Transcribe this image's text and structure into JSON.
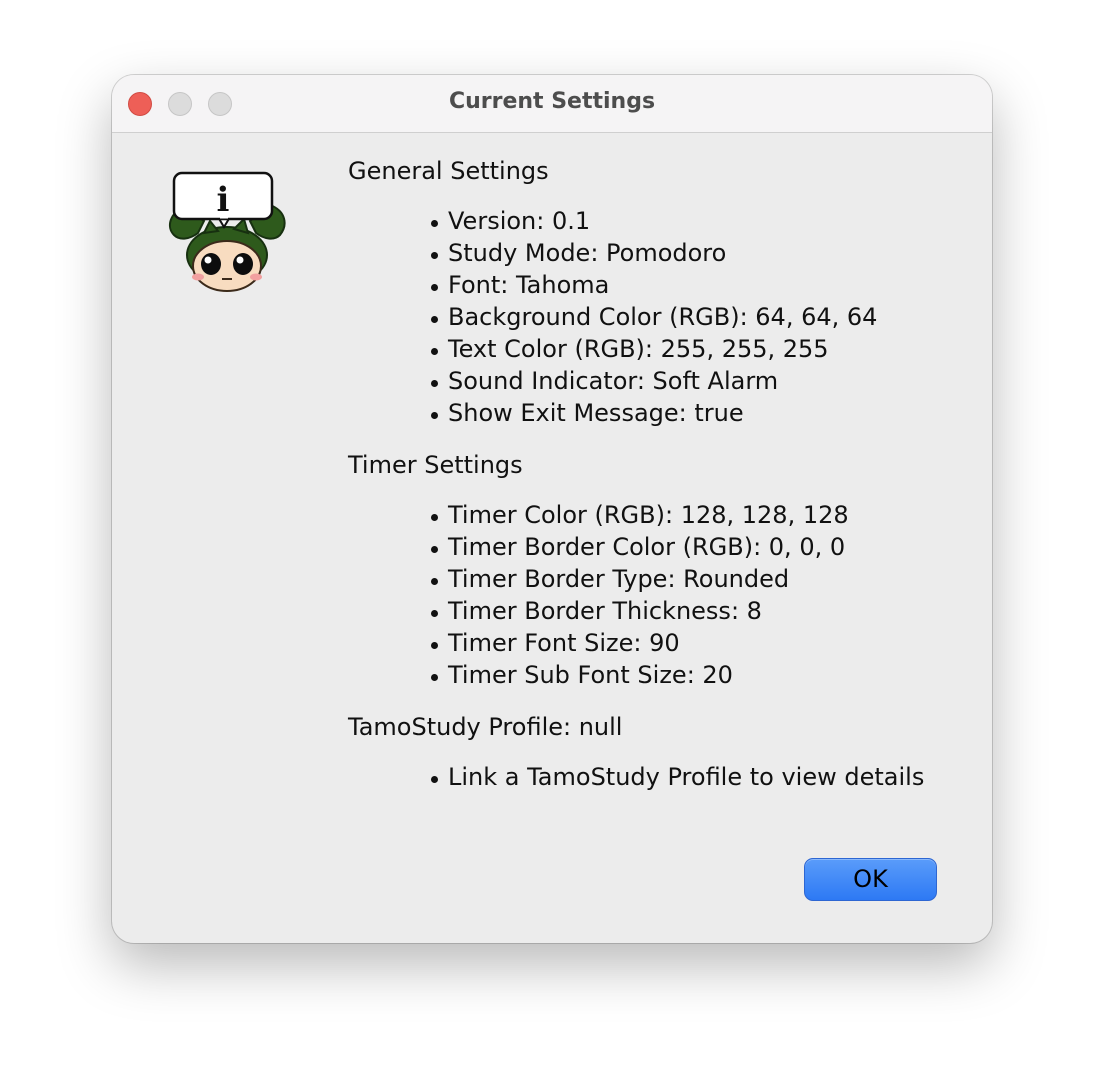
{
  "window": {
    "title": "Current Settings"
  },
  "icon": {
    "semantic": "info-mascot-icon",
    "glyph": "i"
  },
  "sections": {
    "general": {
      "title": "General Settings",
      "items": [
        "Version: 0.1",
        "Study Mode: Pomodoro",
        "Font: Tahoma",
        "Background Color (RGB): 64, 64, 64",
        "Text Color (RGB): 255, 255, 255",
        "Sound Indicator: Soft Alarm",
        "Show Exit Message: true"
      ]
    },
    "timer": {
      "title": "Timer Settings",
      "items": [
        "Timer Color (RGB): 128, 128, 128",
        "Timer Border Color (RGB): 0, 0, 0",
        "Timer Border Type: Rounded",
        "Timer Border Thickness: 8",
        "Timer Font Size: 90",
        "Timer Sub Font Size: 20"
      ]
    },
    "profile": {
      "title": "TamoStudy Profile: null",
      "items": [
        "Link a TamoStudy Profile to view details"
      ]
    }
  },
  "buttons": {
    "ok_label": "OK"
  },
  "colors": {
    "close": "#ee5f57",
    "button_accent": "#2d79f4",
    "mascot_green": "#2e5a1c"
  }
}
